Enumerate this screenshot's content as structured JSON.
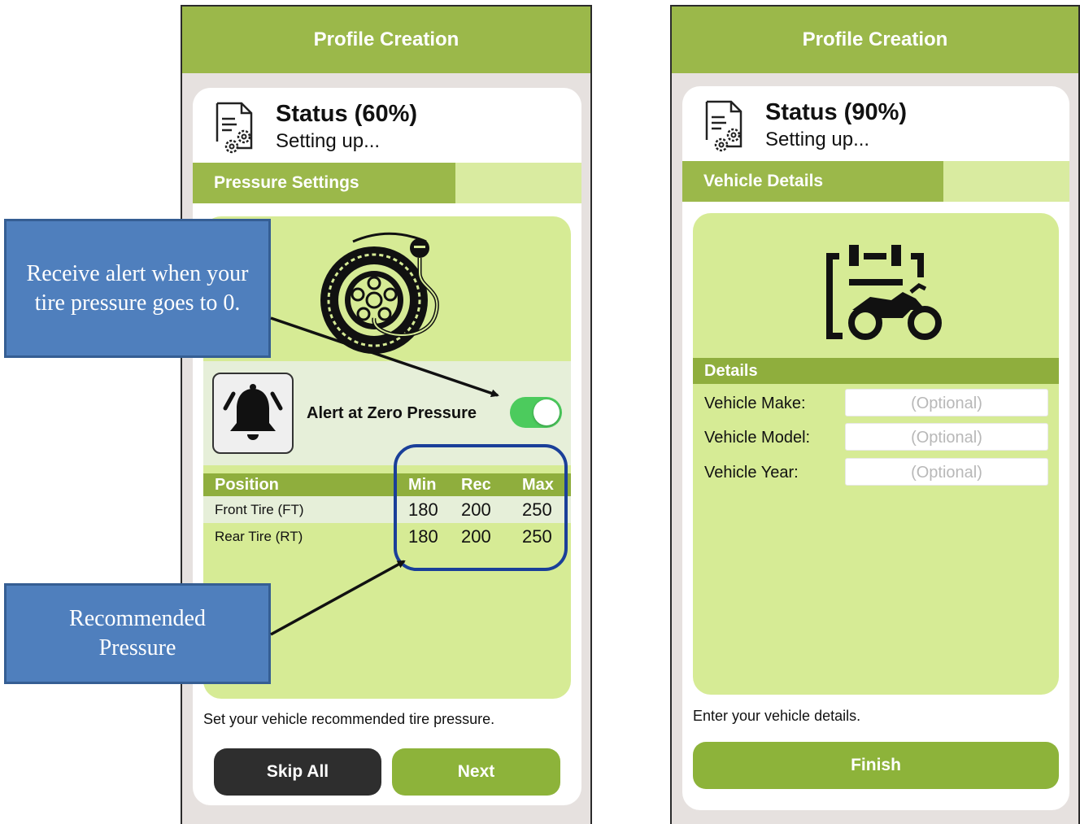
{
  "screen1": {
    "header_title": "Profile Creation",
    "status_title": "Status (60%)",
    "status_subtitle": "Setting up...",
    "progress_label": "Pressure Settings",
    "progress_fraction": 0.675,
    "alert_label": "Alert at Zero Pressure",
    "alert_enabled": true,
    "table": {
      "headers": [
        "Position",
        "Min",
        "Rec",
        "Max"
      ],
      "rows": [
        {
          "position": "Front Tire (FT)",
          "min": "180",
          "rec": "200",
          "max": "250"
        },
        {
          "position": "Rear Tire (RT)",
          "min": "180",
          "rec": "200",
          "max": "250"
        }
      ]
    },
    "hint": "Set your vehicle recommended tire pressure.",
    "skip_label": "Skip All",
    "next_label": "Next"
  },
  "screen2": {
    "header_title": "Profile Creation",
    "status_title": "Status (90%)",
    "status_subtitle": "Setting up...",
    "progress_label": "Vehicle Details",
    "progress_fraction": 0.675,
    "details_header": "Details",
    "fields": [
      {
        "label": "Vehicle Make:",
        "placeholder": "(Optional)"
      },
      {
        "label": "Vehicle Model:",
        "placeholder": "(Optional)"
      },
      {
        "label": "Vehicle Year:",
        "placeholder": "(Optional)"
      }
    ],
    "hint": "Enter your vehicle details.",
    "finish_label": "Finish"
  },
  "annotations": {
    "alert_callout": "Receive alert when your tire pressure goes to 0.",
    "pressure_callout": "Recommended Pressure"
  },
  "icons": {
    "status": "document-gear-icon",
    "tire": "tire-pressure-gauge-icon",
    "bell": "alarm-bell-icon",
    "vehicle": "motorcycle-clipboard-icon"
  },
  "colors": {
    "header": "#9bb84a",
    "panel": "#d6eb95",
    "toggle_on": "#4ccb5d",
    "primary_button": "#8db33a",
    "dark_button": "#2e2e2e",
    "callout": "#4f7fbd",
    "highlight": "#1a3f99"
  }
}
